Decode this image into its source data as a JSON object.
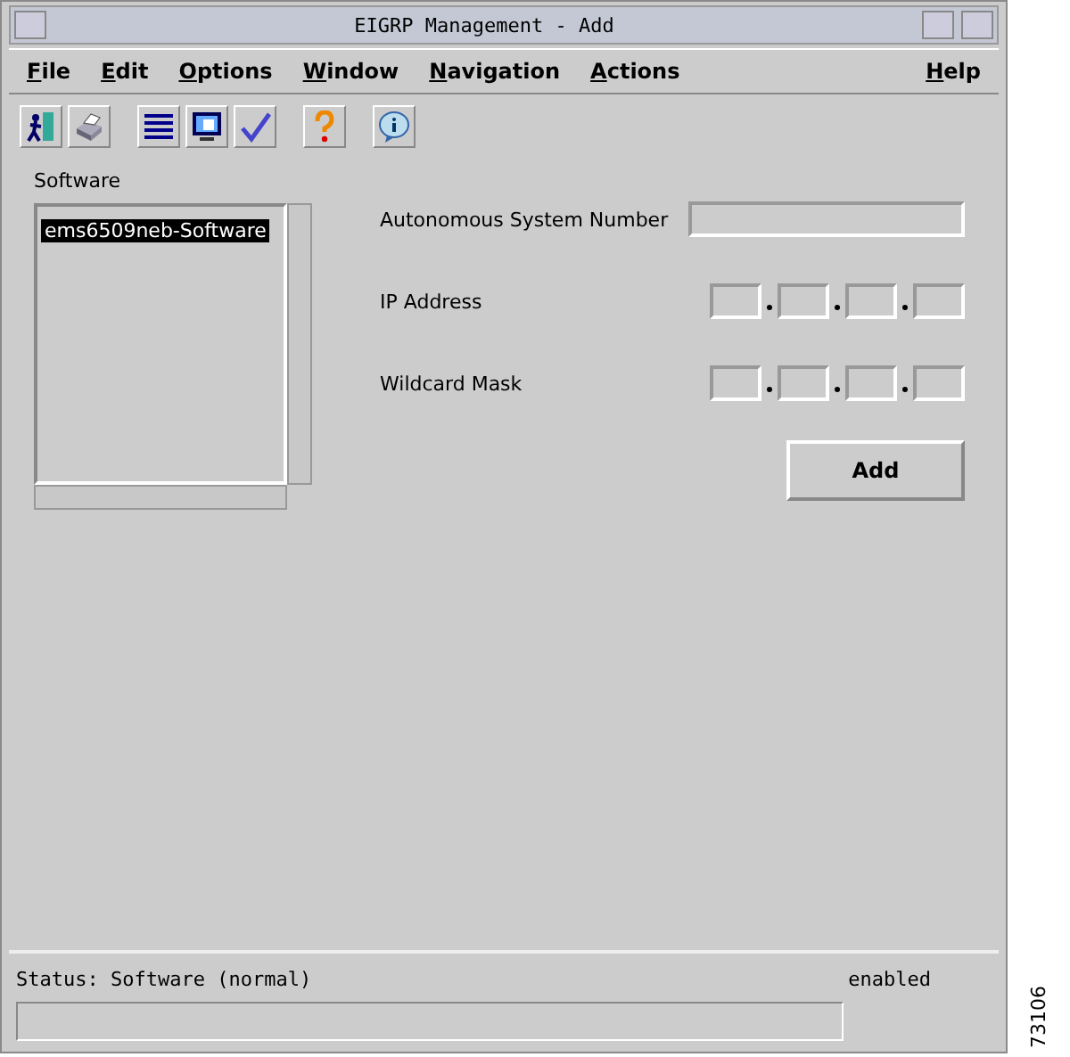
{
  "window": {
    "title": "EIGRP Management - Add"
  },
  "menu": [
    "File",
    "Edit",
    "Options",
    "Window",
    "Navigation",
    "Actions"
  ],
  "help_menu": "Help",
  "toolbar": [
    {
      "kind": "exit"
    },
    {
      "kind": "print"
    },
    {
      "kind": "list"
    },
    {
      "kind": "monitor"
    },
    {
      "kind": "check"
    },
    {
      "kind": "help"
    },
    {
      "kind": "info"
    }
  ],
  "software": {
    "label": "Software",
    "items": [
      {
        "text": "ems6509neb-Software",
        "selected": true
      }
    ]
  },
  "fields": [
    {
      "label": "Autonomous System Number",
      "kind": "text"
    },
    {
      "label": "IP Address",
      "kind": "ip"
    },
    {
      "label": "Wildcard Mask",
      "kind": "ip"
    }
  ],
  "add_button": "Add",
  "status": {
    "text": "Status: Software (normal)",
    "state": "enabled"
  },
  "figure_id": "73106"
}
